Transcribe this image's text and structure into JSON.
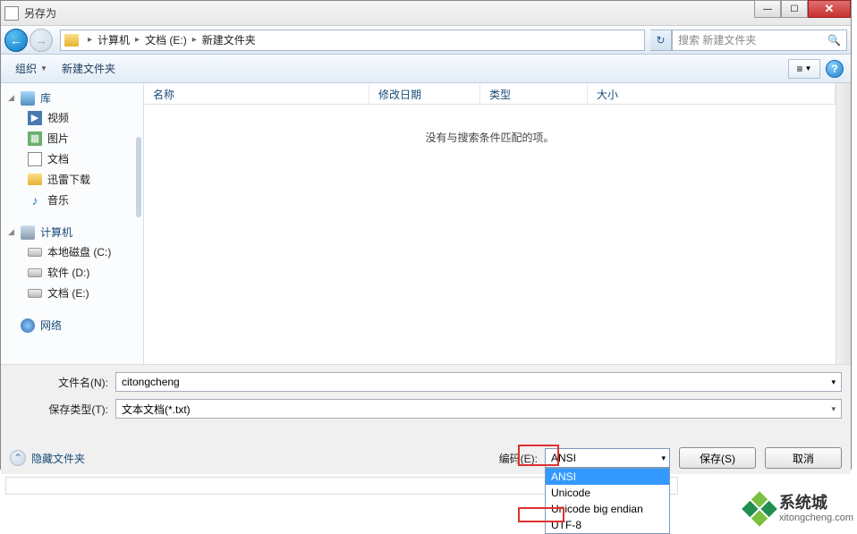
{
  "title": "另存为",
  "breadcrumb": {
    "item1": "计算机",
    "item2": "文档 (E:)",
    "item3": "新建文件夹"
  },
  "search": {
    "placeholder": "搜索 新建文件夹"
  },
  "toolbar": {
    "organize": "组织",
    "newfolder": "新建文件夹"
  },
  "columns": {
    "name": "名称",
    "modified": "修改日期",
    "type": "类型",
    "size": "大小"
  },
  "empty_message": "没有与搜索条件匹配的项。",
  "sidebar": {
    "lib": "库",
    "video": "视频",
    "pictures": "图片",
    "documents": "文档",
    "thunder": "迅雷下载",
    "music": "音乐",
    "computer": "计算机",
    "disk_c": "本地磁盘 (C:)",
    "disk_d": "软件 (D:)",
    "disk_e": "文档 (E:)",
    "network": "网络"
  },
  "form": {
    "filename_label": "文件名(N):",
    "filename_value": "citongcheng",
    "filetype_label": "保存类型(T):",
    "filetype_value": "文本文档(*.txt)",
    "encoding_label": "编码(E):",
    "encoding_value": "ANSI"
  },
  "dropdown": {
    "opt1": "ANSI",
    "opt2": "Unicode",
    "opt3": "Unicode big endian",
    "opt4": "UTF-8"
  },
  "buttons": {
    "hide": "隐藏文件夹",
    "save": "保存(S)",
    "cancel": "取消"
  },
  "watermark": {
    "cn": "系统城",
    "en": "xitongcheng.com"
  }
}
